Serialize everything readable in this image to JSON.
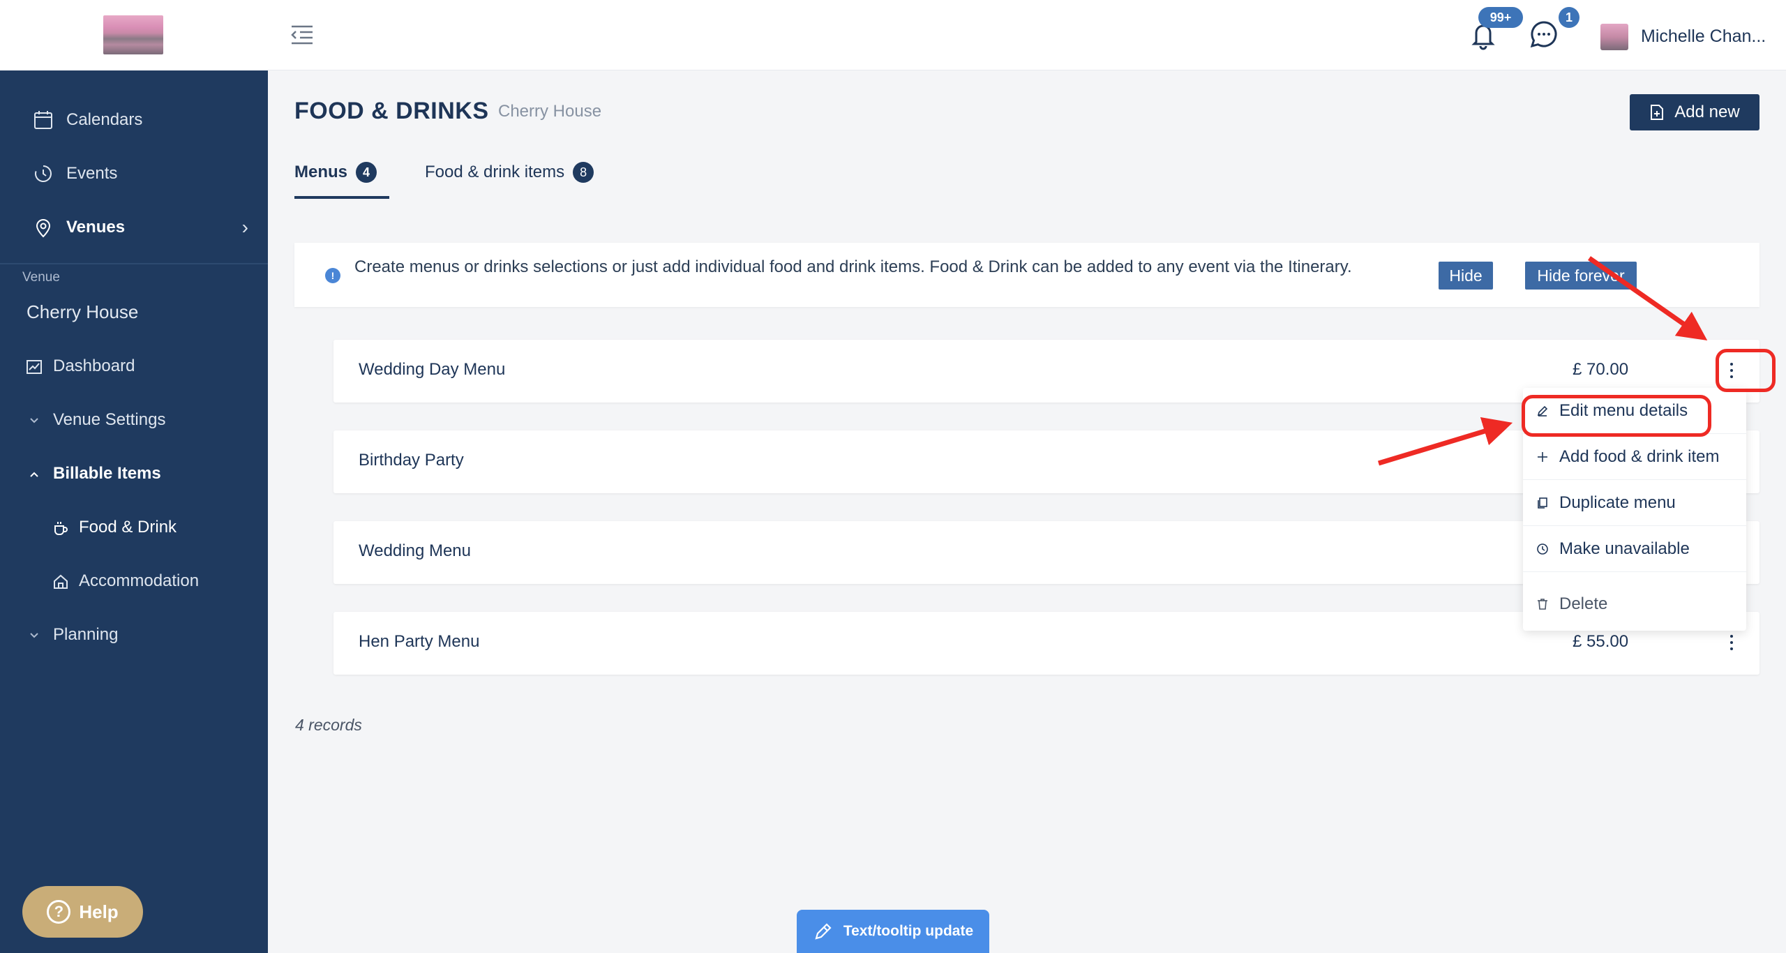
{
  "sidebar": {
    "nav": [
      {
        "label": "Calendars",
        "icon": "calendar-icon"
      },
      {
        "label": "Events",
        "icon": "history-icon"
      },
      {
        "label": "Venues",
        "icon": "location-pin-icon"
      }
    ],
    "venue_label": "Venue",
    "venue_name": "Cherry House",
    "items": [
      {
        "label": "Dashboard",
        "icon": "chart-icon"
      },
      {
        "label": "Venue Settings",
        "icon": "chevron-down-icon"
      },
      {
        "label": "Billable Items",
        "icon": "chevron-up-icon"
      },
      {
        "label": "Food & Drink",
        "icon": "cup-icon"
      },
      {
        "label": "Accommodation",
        "icon": "home-icon"
      },
      {
        "label": "Planning",
        "icon": "chevron-down-icon"
      }
    ],
    "help_label": "Help"
  },
  "topbar": {
    "notifications_badge": "99+",
    "messages_badge": "1",
    "user_name": "Michelle Chan..."
  },
  "page": {
    "title": "FOOD & DRINKS",
    "subtitle": "Cherry House",
    "add_new_label": "Add new",
    "tabs": [
      {
        "label": "Menus",
        "count": "4"
      },
      {
        "label": "Food & drink items",
        "count": "8"
      }
    ],
    "info_text": "Create menus or drinks selections or just add individual food and drink items. Food & Drink can be added to any event via the Itinerary.",
    "hide_label": "Hide",
    "hide_forever_label": "Hide forever",
    "menus": [
      {
        "name": "Wedding Day Menu",
        "price": "£ 70.00"
      },
      {
        "name": "Birthday Party",
        "price": ""
      },
      {
        "name": "Wedding Menu",
        "price": ""
      },
      {
        "name": "Hen Party Menu",
        "price": "£ 55.00"
      }
    ],
    "records": "4 records"
  },
  "dropdown": [
    {
      "label": "Edit menu details",
      "icon": "pencil-icon"
    },
    {
      "label": "Add food & drink item",
      "icon": "plus-icon"
    },
    {
      "label": "Duplicate menu",
      "icon": "copy-icon"
    },
    {
      "label": "Make unavailable",
      "icon": "clock-icon"
    },
    {
      "label": "Delete",
      "icon": "trash-icon"
    }
  ],
  "floating_button": "Text/tooltip update",
  "colors": {
    "sidebar": "#1f3a5f",
    "accent": "#3d74b8",
    "annotation": "#ee2a24",
    "help": "#c9ad78"
  }
}
